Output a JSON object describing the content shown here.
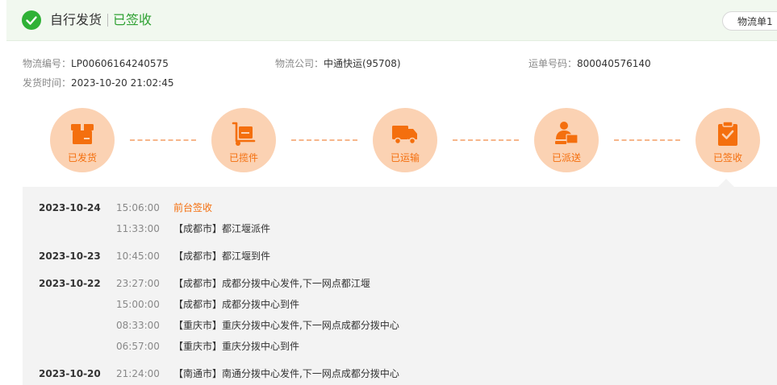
{
  "header": {
    "mode": "自行发货",
    "status": "已签收",
    "tab_label": "物流单1"
  },
  "info": {
    "tracking_label": "物流编号：",
    "tracking_value": "LP00606164240575",
    "company_label": "物流公司：",
    "company_value": "中通快运(95708)",
    "waybill_label": "运单号码：",
    "waybill_value": "800040576140",
    "ship_time_label": "发货时间：",
    "ship_time_value": "2023-10-20 21:02:45"
  },
  "steps": [
    {
      "label": "已发货",
      "icon": "box-icon"
    },
    {
      "label": "已揽件",
      "icon": "hand-truck-icon"
    },
    {
      "label": "已运输",
      "icon": "truck-icon"
    },
    {
      "label": "已派送",
      "icon": "courier-icon"
    },
    {
      "label": "已签收",
      "icon": "clipboard-check-icon"
    }
  ],
  "log": [
    {
      "date": "2023-10-24",
      "time": "15:06:00",
      "msg": "前台签收",
      "highlight": true
    },
    {
      "date": "",
      "time": "11:33:00",
      "msg": "【成都市】都江堰派件"
    },
    {
      "date": "2023-10-23",
      "time": "10:45:00",
      "msg": "【成都市】都江堰到件"
    },
    {
      "date": "2023-10-22",
      "time": "23:27:00",
      "msg": "【成都市】成都分拨中心发件,下一网点都江堰"
    },
    {
      "date": "",
      "time": "15:00:00",
      "msg": "【成都市】成都分拨中心到件"
    },
    {
      "date": "",
      "time": "08:33:00",
      "msg": "【重庆市】重庆分拨中心发件,下一网点成都分拨中心"
    },
    {
      "date": "",
      "time": "06:57:00",
      "msg": "【重庆市】重庆分拨中心到件"
    },
    {
      "date": "2023-10-20",
      "time": "21:24:00",
      "msg": "【南通市】南通分拨中心发件,下一网点成都分拨中心"
    }
  ],
  "colors": {
    "accent_green": "#2fb136",
    "accent_orange": "#f46f0e",
    "step_circle": "#fbd2b3"
  }
}
